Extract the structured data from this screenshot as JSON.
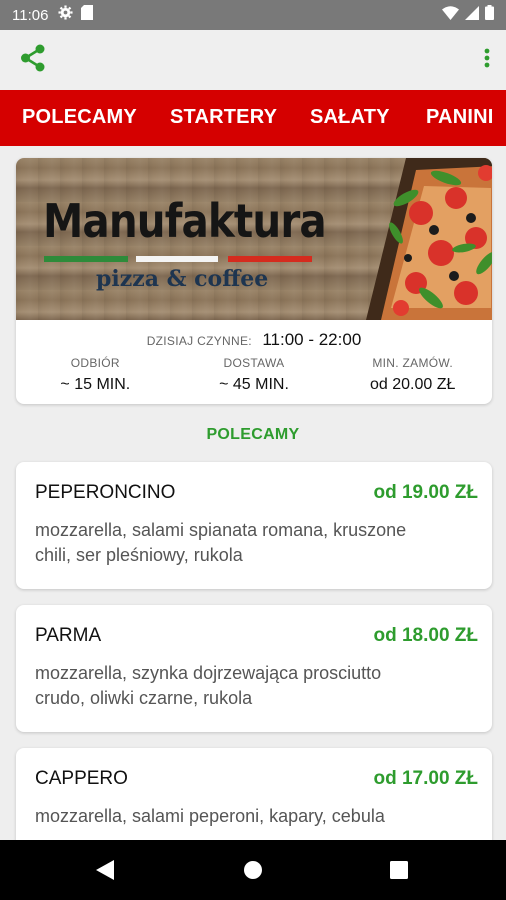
{
  "status_bar": {
    "time": "11:06",
    "icons": [
      "gear-icon",
      "sd-card-icon",
      "wifi-icon",
      "signal-icon",
      "battery-icon"
    ]
  },
  "app_bar": {
    "share_icon": "share-icon",
    "menu_icon": "more-vert-icon",
    "accent_color": "#2e9c2e"
  },
  "tabs": [
    {
      "label": "POLECAMY"
    },
    {
      "label": "STARTERY"
    },
    {
      "label": "SAŁATY"
    },
    {
      "label": "PANINI"
    }
  ],
  "tab_bar_color": "#d50000",
  "restaurant": {
    "logo_title": "Manufaktura",
    "logo_subtitle": "pizza & coffee",
    "hours_label": "DZISIAJ CZYNNE:",
    "hours_value": "11:00 - 22:00",
    "info": [
      {
        "label": "ODBIÓR",
        "value": "~ 15 MIN."
      },
      {
        "label": "DOSTAWA",
        "value": "~ 45 MIN."
      },
      {
        "label": "MIN. ZAMÓW.",
        "value": "od 20.00 ZŁ"
      }
    ]
  },
  "section_title": "POLECAMY",
  "menu_items": [
    {
      "name": "PEPERONCINO",
      "price": "od 19.00 ZŁ",
      "desc_line1": "mozzarella, salami spianata romana, kruszone",
      "desc_line2": "chili, ser pleśniowy, rukola"
    },
    {
      "name": "PARMA",
      "price": "od 18.00 ZŁ",
      "desc_line1": "mozzarella, szynka dojrzewająca prosciutto",
      "desc_line2": "crudo, oliwki czarne, rukola"
    },
    {
      "name": "CAPPERO",
      "price": "od 17.00 ZŁ",
      "desc_line1": "mozzarella, salami peperoni, kapary, cebula",
      "desc_line2": ""
    }
  ],
  "nav_bar": {
    "icons": [
      "back-icon",
      "home-icon",
      "recents-icon"
    ]
  }
}
